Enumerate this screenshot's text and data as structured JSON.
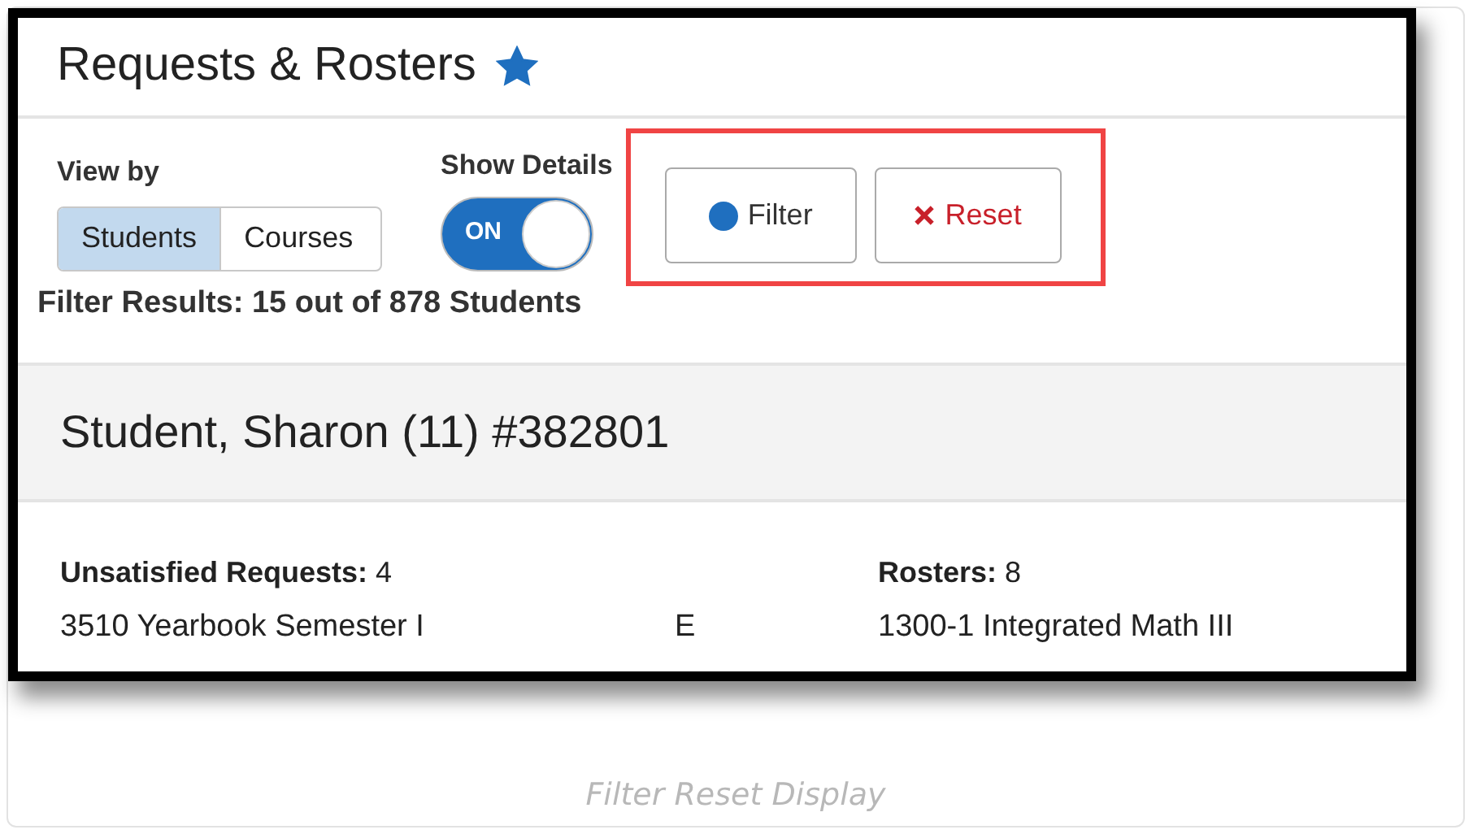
{
  "page_title": "Requests & Rosters",
  "favorite": true,
  "view_by": {
    "label": "View by",
    "options": [
      {
        "label": "Students",
        "selected": true
      },
      {
        "label": "Courses",
        "selected": false
      }
    ]
  },
  "show_details": {
    "label": "Show Details",
    "on": true,
    "state_text": "ON"
  },
  "buttons": [
    {
      "kind": "filter",
      "label": "Filter"
    },
    {
      "kind": "reset",
      "label": "Reset"
    }
  ],
  "filter_results": "Filter Results: 15 out of 878 Students",
  "student_header": "Student, Sharon (11) #382801",
  "unsatisfied": {
    "label": "Unsatisfied Requests:",
    "count": "4",
    "rows": [
      {
        "course": "3510 Yearbook Semester I",
        "code": "E"
      }
    ]
  },
  "rosters": {
    "label": "Rosters:",
    "count": "8",
    "rows": [
      {
        "course": "1300-1 Integrated Math III"
      }
    ]
  },
  "caption": "Filter Reset Display"
}
